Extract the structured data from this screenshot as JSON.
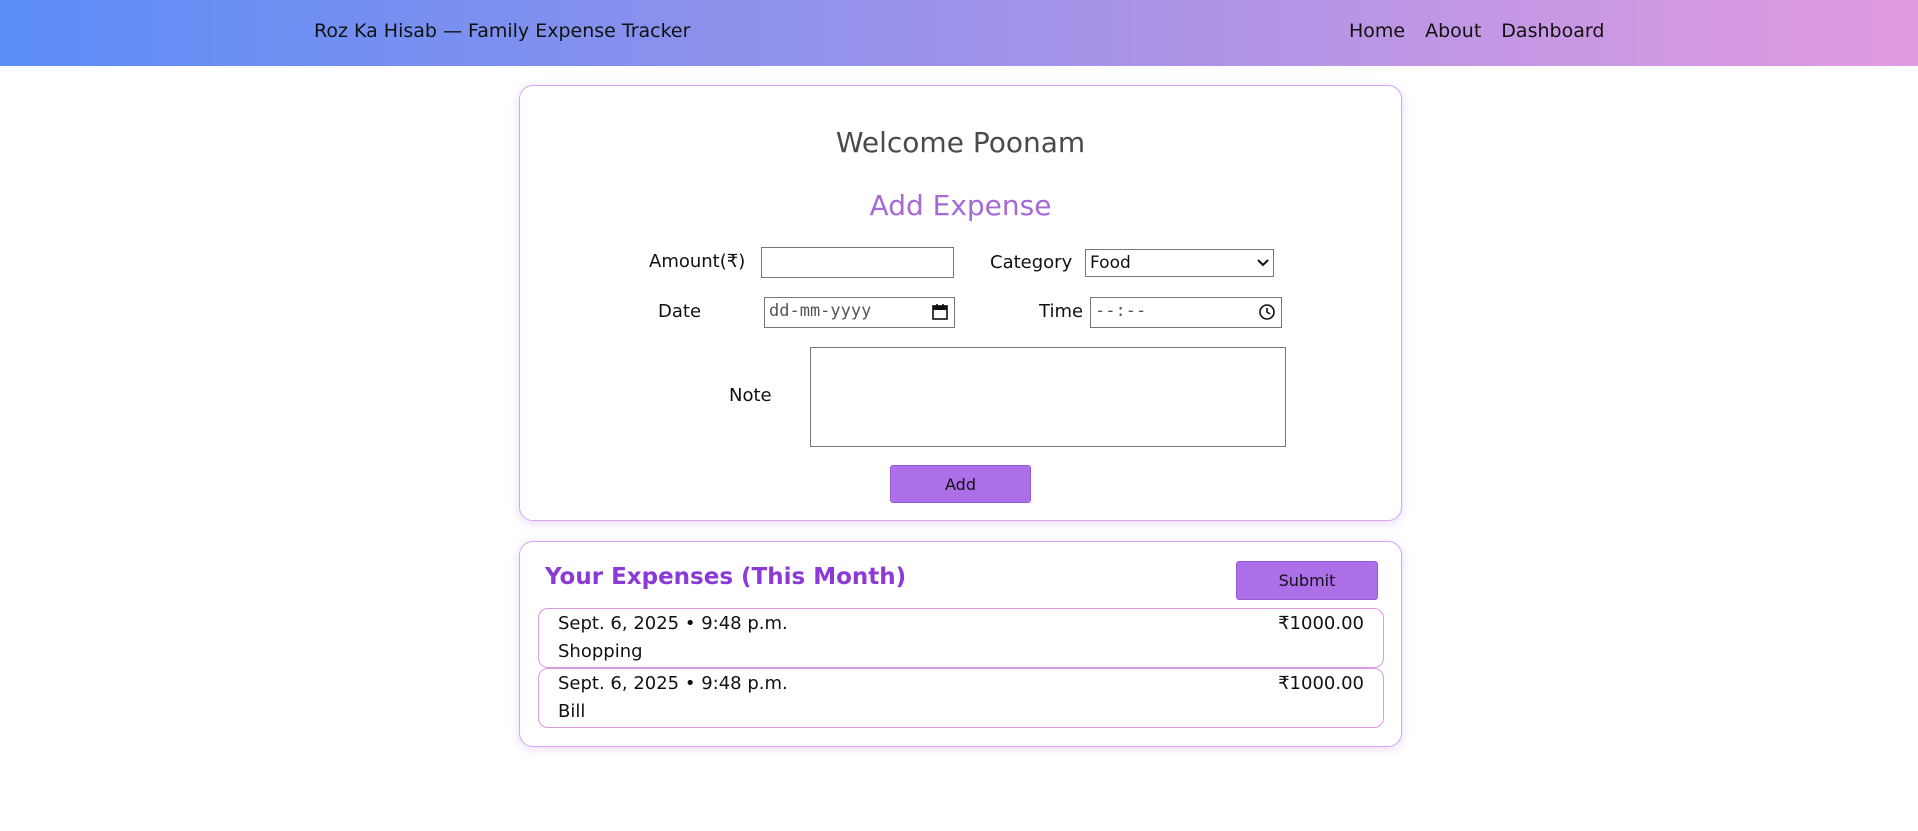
{
  "app": {
    "brand": "Roz Ka Hisab — Family Expense Tracker",
    "nav": [
      "Home",
      "About",
      "Dashboard"
    ]
  },
  "form": {
    "welcome": "Welcome Poonam",
    "title": "Add Expense",
    "amount_label": "Amount(₹)",
    "amount_value": "",
    "category_label": "Category",
    "category_selected": "Food",
    "date_label": "Date",
    "date_placeholder": "dd-mm-yyyy",
    "time_label": "Time",
    "time_placeholder": "--:--",
    "note_label": "Note",
    "note_value": "",
    "add_button": "Add"
  },
  "expenses": {
    "title": "Your Expenses (This Month)",
    "submit_button": "Submit",
    "items": [
      {
        "datetime": "Sept. 6, 2025 • 9:48 p.m.",
        "category": "Shopping",
        "amount": "₹1000.00"
      },
      {
        "datetime": "Sept. 6, 2025 • 9:48 p.m.",
        "category": "Bill",
        "amount": "₹1000.00"
      }
    ]
  },
  "colors": {
    "accent": "#ac6fe8",
    "heading_purple": "#8b3ad6",
    "card_border": "#d9a6ee",
    "nav_gradient_start": "#5b8df6",
    "nav_gradient_end": "#e29be0"
  }
}
